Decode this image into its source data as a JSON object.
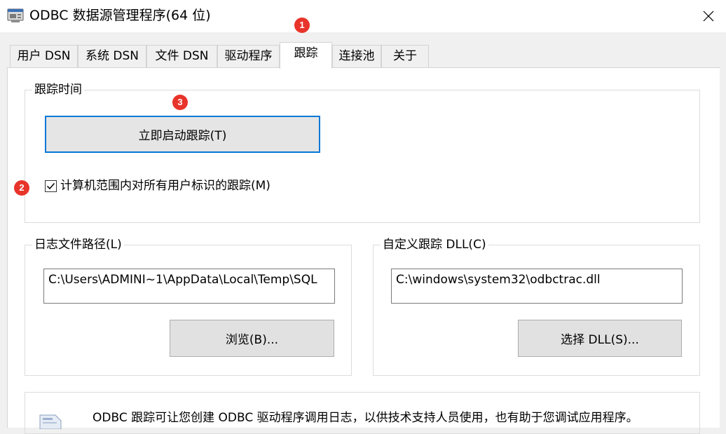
{
  "window": {
    "title": "ODBC 数据源管理程序(64 位)"
  },
  "tabs": [
    {
      "label": "用户 DSN"
    },
    {
      "label": "系统 DSN"
    },
    {
      "label": "文件 DSN"
    },
    {
      "label": "驱动程序"
    },
    {
      "label": "跟踪"
    },
    {
      "label": "连接池"
    },
    {
      "label": "关于"
    }
  ],
  "active_tab": "跟踪",
  "trace_group": {
    "legend": "跟踪时间",
    "start_button": "立即启动跟踪(T)",
    "machine_wide_checkbox": {
      "label": "计算机范围内对所有用户标识的跟踪(M)",
      "checked": true
    }
  },
  "log_group": {
    "legend": "日志文件路径(L)",
    "path_value": "C:\\Users\\ADMINI~1\\AppData\\Local\\Temp\\SQL",
    "browse_button": "浏览(B)..."
  },
  "dll_group": {
    "legend": "自定义跟踪 DLL(C)",
    "dll_value": "C:\\windows\\system32\\odbctrac.dll",
    "select_button": "选择 DLL(S)..."
  },
  "info": {
    "text": "ODBC 跟踪可让您创建 ODBC 驱动程序调用日志，以供技术支持人员使用，也有助于您调试应用程序。"
  },
  "annotations": {
    "marker1": "1",
    "marker2": "2",
    "marker3": "3"
  },
  "colors": {
    "marker": "#e8342a",
    "focus_border": "#0078d7",
    "tab_active": "#ffffff"
  },
  "icons": {
    "app": "odbc-app-icon",
    "close": "close-icon",
    "info": "info-document-icon"
  }
}
